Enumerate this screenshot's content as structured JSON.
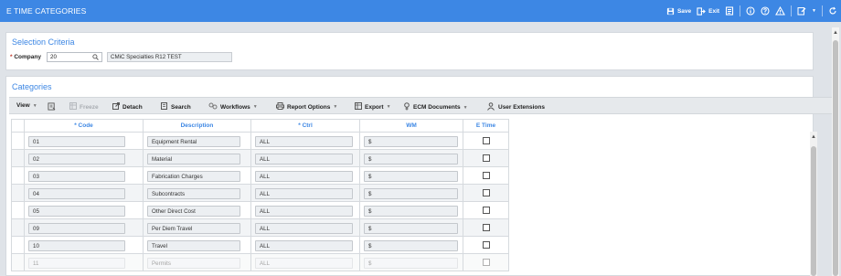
{
  "window": {
    "title": "E TIME CATEGORIES"
  },
  "toolbar": {
    "save_label": "Save",
    "exit_label": "Exit"
  },
  "selection": {
    "title": "Selection Criteria",
    "company_label": "Company",
    "company_value": "20",
    "company_name": "CMiC Specialties R12 TEST"
  },
  "categories": {
    "title": "Categories",
    "toolbar": {
      "view": "View",
      "freeze": "Freeze",
      "detach": "Detach",
      "search": "Search",
      "workflows": "Workflows",
      "report_options": "Report Options",
      "export": "Export",
      "ecm_documents": "ECM Documents",
      "user_extensions": "User Extensions"
    },
    "columns": {
      "code": "Code",
      "description": "Description",
      "ctrl": "Ctrl",
      "wm": "WM",
      "etime": "E Time"
    },
    "rows": [
      {
        "code": "01",
        "description": "Equipment Rental",
        "ctrl": "ALL",
        "wm": "$"
      },
      {
        "code": "02",
        "description": "Material",
        "ctrl": "ALL",
        "wm": "$"
      },
      {
        "code": "03",
        "description": "Fabrication Charges",
        "ctrl": "ALL",
        "wm": "$"
      },
      {
        "code": "04",
        "description": "Subcontracts",
        "ctrl": "ALL",
        "wm": "$"
      },
      {
        "code": "05",
        "description": "Other Direct Cost",
        "ctrl": "ALL",
        "wm": "$"
      },
      {
        "code": "09",
        "description": "Per Diem Travel",
        "ctrl": "ALL",
        "wm": "$"
      },
      {
        "code": "10",
        "description": "Travel",
        "ctrl": "ALL",
        "wm": "$"
      },
      {
        "code": "11",
        "description": "Permits",
        "ctrl": "ALL",
        "wm": "$"
      }
    ]
  },
  "colors": {
    "accent": "#3d87e4",
    "titlebar": "#3d87e4"
  },
  "icons": [
    "save-icon",
    "exit-icon",
    "report-icon",
    "info-icon",
    "help-icon",
    "warning-icon",
    "edit-icon",
    "refresh-icon",
    "search-icon"
  ]
}
